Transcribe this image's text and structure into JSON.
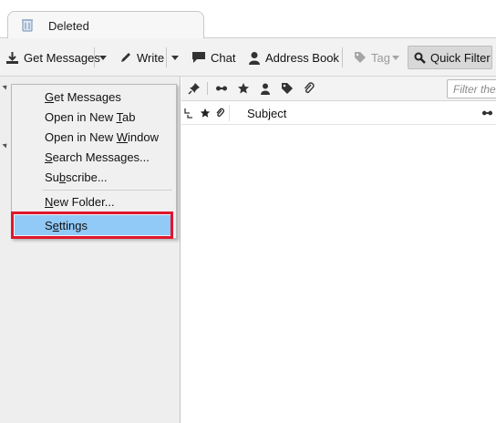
{
  "tab": {
    "title": "Deleted"
  },
  "toolbar": {
    "get_messages": "Get Messages",
    "write": "Write",
    "chat": "Chat",
    "address_book": "Address Book",
    "tag": "Tag",
    "quick_filter": "Quick Filter"
  },
  "filter": {
    "placeholder": "Filter thes"
  },
  "columns": {
    "subject": "Subject"
  },
  "context_menu": {
    "items": [
      {
        "pre": "",
        "ul": "G",
        "post": "et Messages"
      },
      {
        "pre": "Open in New ",
        "ul": "T",
        "post": "ab"
      },
      {
        "pre": "Open in New ",
        "ul": "W",
        "post": "indow"
      },
      {
        "pre": "",
        "ul": "S",
        "post": "earch Messages..."
      },
      {
        "pre": "Su",
        "ul": "b",
        "post": "scribe..."
      },
      {
        "pre": "",
        "ul": "N",
        "post": "ew Folder..."
      },
      {
        "pre": "S",
        "ul": "e",
        "post": "ttings"
      }
    ],
    "highlighted": "Settings"
  },
  "colors": {
    "highlight": "#91c9f7",
    "annotation_box": "#e0162c"
  },
  "icons": [
    "trash-icon",
    "download-icon",
    "pencil-icon",
    "chat-icon",
    "person-icon",
    "tag-icon",
    "search-icon",
    "pin-icon",
    "thread-icon",
    "star-icon",
    "paperclip-icon",
    "chevron-down-icon"
  ]
}
